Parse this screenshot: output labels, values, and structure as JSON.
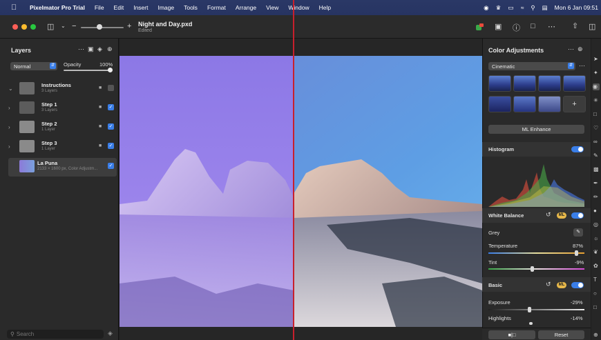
{
  "menubar": {
    "app_name": "Pixelmator Pro Trial",
    "menus": [
      "File",
      "Edit",
      "Insert",
      "Image",
      "Tools",
      "Format",
      "Arrange",
      "View",
      "Window",
      "Help"
    ],
    "clock": "Mon 6 Jan  09:51"
  },
  "document": {
    "title": "Night and Day.pxd",
    "status": "Edited"
  },
  "layers_panel": {
    "title": "Layers",
    "blend_mode": "Normal",
    "opacity_label": "Opacity",
    "opacity_value": "100%",
    "layers": [
      {
        "name": "Instructions",
        "sub": "3 Layers",
        "checked": false
      },
      {
        "name": "Step 1",
        "sub": "3 Layers",
        "checked": true
      },
      {
        "name": "Step 2",
        "sub": "1 Layer",
        "checked": true
      },
      {
        "name": "Step 3",
        "sub": "1 Layer",
        "checked": true
      },
      {
        "name": "La Puna",
        "sub": "2133 × 1600 px, Color Adjustm...",
        "checked": true
      }
    ],
    "search_placeholder": "Search"
  },
  "adjustments_panel": {
    "title": "Color Adjustments",
    "preset": "Cinematic",
    "ml_enhance": "ML Enhance",
    "histogram_label": "Histogram",
    "white_balance_label": "White Balance",
    "ml_badge": "ML",
    "grey_label": "Grey",
    "temperature_label": "Temperature",
    "temperature_value": "87%",
    "tint_label": "Tint",
    "tint_value": "-9%",
    "basic_label": "Basic",
    "exposure_label": "Exposure",
    "exposure_value": "-29%",
    "highlights_label": "Highlights",
    "highlights_value": "-14%",
    "reset_label": "Reset"
  },
  "colors": {
    "accent": "#3a7ee8",
    "divider": "#c8202c",
    "ml": "#e7b84a"
  }
}
